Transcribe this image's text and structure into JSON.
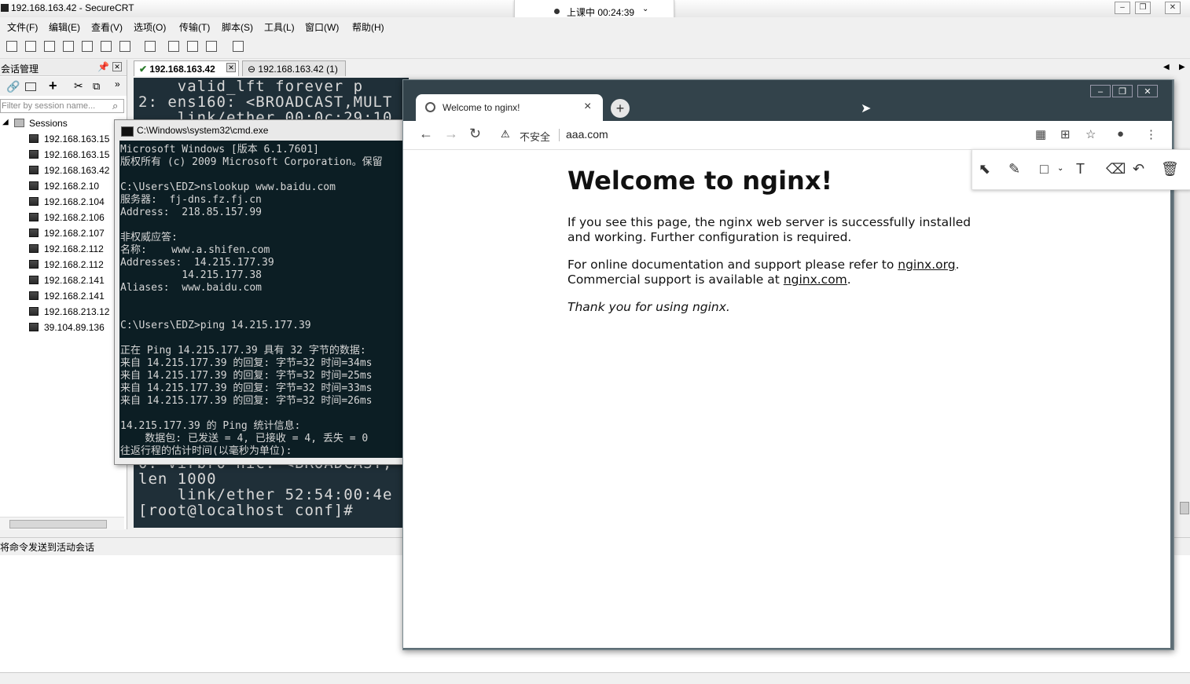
{
  "crt": {
    "title": "192.168.163.42 - SecureCRT",
    "menu": [
      "文件(F)",
      "编辑(E)",
      "查看(V)",
      "选项(O)",
      "传输(T)",
      "脚本(S)",
      "工具(L)",
      "窗口(W)",
      "帮助(H)"
    ],
    "session_panel": {
      "title": "会话管理",
      "filter_placeholder": "Filter by session name...",
      "root": "Sessions",
      "items": [
        "192.168.163.15",
        "192.168.163.15",
        "192.168.163.42",
        "192.168.2.10",
        "192.168.2.104",
        "192.168.2.106",
        "192.168.2.107",
        "192.168.2.112",
        "192.168.2.112",
        "192.168.2.141",
        "192.168.2.141",
        "192.168.213.12",
        "39.104.89.136"
      ]
    },
    "tabs": [
      {
        "label": "192.168.163.42",
        "active": true
      },
      {
        "label": "192.168.163.42 (1)",
        "active": false
      }
    ],
    "terminal_lines": [
      "    valid_lft forever p",
      "2: ens160: <BROADCAST,MULT",
      "    link/ether 00:0c:29:10",
      "0: virbr0-nic: <BROADCAST,",
      "len 1000",
      "    link/ether 52:54:00:4e",
      "[root@localhost conf]#"
    ],
    "command_bar": "将命令发送到活动会话"
  },
  "recording": {
    "text": "上课中 00:24:39"
  },
  "cmd": {
    "title": "C:\\Windows\\system32\\cmd.exe",
    "lines": [
      "Microsoft Windows [版本 6.1.7601]",
      "版权所有 (c) 2009 Microsoft Corporation。保留",
      "",
      "C:\\Users\\EDZ>nslookup www.baidu.com",
      "服务器:  fj-dns.fz.fj.cn",
      "Address:  218.85.157.99",
      "",
      "非权威应答:",
      "名称:    www.a.shifen.com",
      "Addresses:  14.215.177.39",
      "          14.215.177.38",
      "Aliases:  www.baidu.com",
      "",
      "",
      "C:\\Users\\EDZ>ping 14.215.177.39",
      "",
      "正在 Ping 14.215.177.39 具有 32 字节的数据:",
      "来自 14.215.177.39 的回复: 字节=32 时间=34ms",
      "来自 14.215.177.39 的回复: 字节=32 时间=25ms",
      "来自 14.215.177.39 的回复: 字节=32 时间=33ms",
      "来自 14.215.177.39 的回复: 字节=32 时间=26ms",
      "",
      "14.215.177.39 的 Ping 统计信息:",
      "    数据包: 已发送 = 4, 已接收 = 4, 丢失 = 0",
      "往返行程的估计时间(以毫秒为单位):"
    ]
  },
  "browser": {
    "tab_title": "Welcome to nginx!",
    "security": "不安全",
    "url": "aaa.com",
    "page": {
      "heading": "Welcome to nginx!",
      "p1": "If you see this page, the nginx web server is successfully installed and working. Further configuration is required.",
      "p2_prefix": "For online documentation and support please refer to ",
      "p2_link": "nginx.org",
      "p2_suffix": ".",
      "p3_prefix": "Commercial support is available at ",
      "p3_link": "nginx.com",
      "p3_suffix": ".",
      "p4": "Thank you for using nginx."
    }
  }
}
